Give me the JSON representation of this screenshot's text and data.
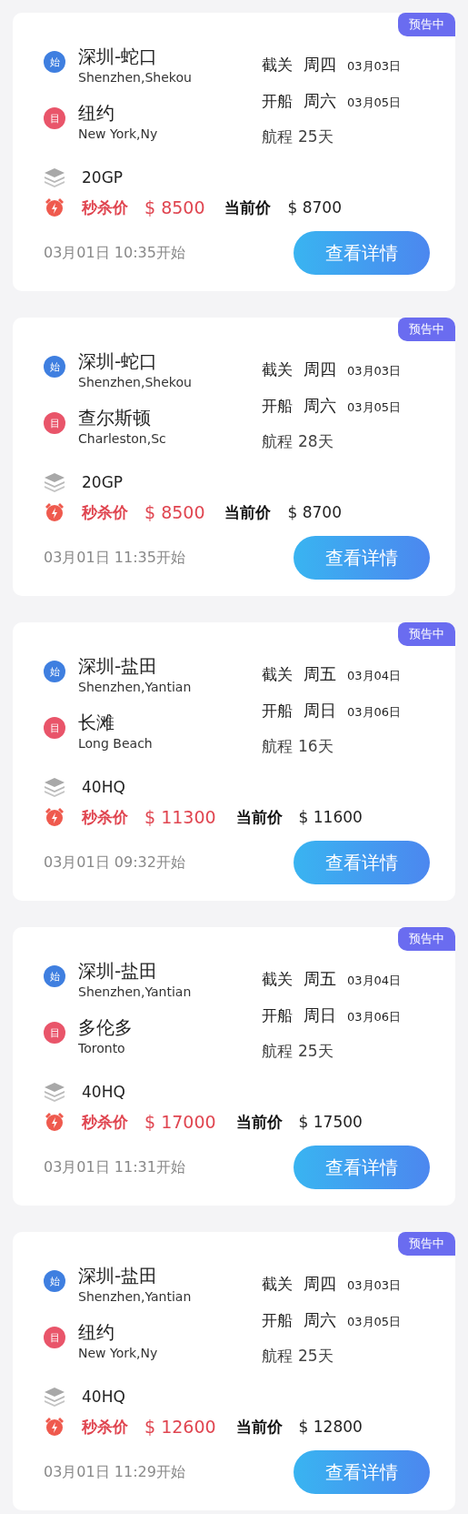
{
  "cards": [
    {
      "badge": "预告中",
      "origin": {
        "marker": "始",
        "name": "深圳-蛇口",
        "name_en": "Shenzhen,Shekou"
      },
      "destination": {
        "marker": "目",
        "name": "纽约",
        "name_en": "New York,Ny"
      },
      "cutoff": {
        "label": "截关",
        "weekday": "周四",
        "date": "03月03日"
      },
      "departure": {
        "label": "开船",
        "weekday": "周六",
        "date": "03月05日"
      },
      "voyage": {
        "label": "航程",
        "value": "25天"
      },
      "container": "20GP",
      "flash": {
        "label": "秒杀价",
        "price": "$ 8500"
      },
      "current": {
        "label": "当前价",
        "price": "$ 8700"
      },
      "start_time": "03月01日 10:35开始",
      "button": "查看详情"
    },
    {
      "badge": "预告中",
      "origin": {
        "marker": "始",
        "name": "深圳-蛇口",
        "name_en": "Shenzhen,Shekou"
      },
      "destination": {
        "marker": "目",
        "name": "查尔斯顿",
        "name_en": "Charleston,Sc"
      },
      "cutoff": {
        "label": "截关",
        "weekday": "周四",
        "date": "03月03日"
      },
      "departure": {
        "label": "开船",
        "weekday": "周六",
        "date": "03月05日"
      },
      "voyage": {
        "label": "航程",
        "value": "28天"
      },
      "container": "20GP",
      "flash": {
        "label": "秒杀价",
        "price": "$ 8500"
      },
      "current": {
        "label": "当前价",
        "price": "$ 8700"
      },
      "start_time": "03月01日 11:35开始",
      "button": "查看详情"
    },
    {
      "badge": "预告中",
      "origin": {
        "marker": "始",
        "name": "深圳-盐田",
        "name_en": "Shenzhen,Yantian"
      },
      "destination": {
        "marker": "目",
        "name": "长滩",
        "name_en": "Long Beach"
      },
      "cutoff": {
        "label": "截关",
        "weekday": "周五",
        "date": "03月04日"
      },
      "departure": {
        "label": "开船",
        "weekday": "周日",
        "date": "03月06日"
      },
      "voyage": {
        "label": "航程",
        "value": "16天"
      },
      "container": "40HQ",
      "flash": {
        "label": "秒杀价",
        "price": "$ 11300"
      },
      "current": {
        "label": "当前价",
        "price": "$ 11600"
      },
      "start_time": "03月01日 09:32开始",
      "button": "查看详情"
    },
    {
      "badge": "预告中",
      "origin": {
        "marker": "始",
        "name": "深圳-盐田",
        "name_en": "Shenzhen,Yantian"
      },
      "destination": {
        "marker": "目",
        "name": "多伦多",
        "name_en": "Toronto"
      },
      "cutoff": {
        "label": "截关",
        "weekday": "周五",
        "date": "03月04日"
      },
      "departure": {
        "label": "开船",
        "weekday": "周日",
        "date": "03月06日"
      },
      "voyage": {
        "label": "航程",
        "value": "25天"
      },
      "container": "40HQ",
      "flash": {
        "label": "秒杀价",
        "price": "$ 17000"
      },
      "current": {
        "label": "当前价",
        "price": "$ 17500"
      },
      "start_time": "03月01日 11:31开始",
      "button": "查看详情"
    },
    {
      "badge": "预告中",
      "origin": {
        "marker": "始",
        "name": "深圳-盐田",
        "name_en": "Shenzhen,Yantian"
      },
      "destination": {
        "marker": "目",
        "name": "纽约",
        "name_en": "New York,Ny"
      },
      "cutoff": {
        "label": "截关",
        "weekday": "周四",
        "date": "03月03日"
      },
      "departure": {
        "label": "开船",
        "weekday": "周六",
        "date": "03月05日"
      },
      "voyage": {
        "label": "航程",
        "value": "25天"
      },
      "container": "40HQ",
      "flash": {
        "label": "秒杀价",
        "price": "$ 12600"
      },
      "current": {
        "label": "当前价",
        "price": "$ 12800"
      },
      "start_time": "03月01日 11:29开始",
      "button": "查看详情"
    }
  ]
}
